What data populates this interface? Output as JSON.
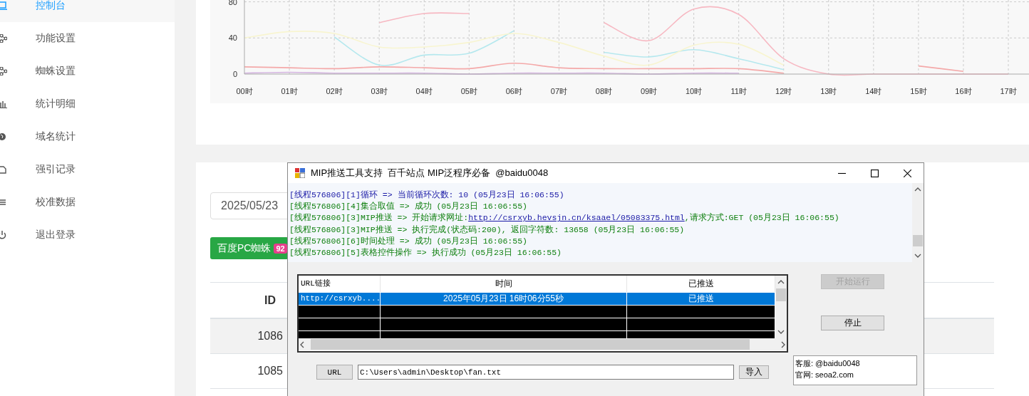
{
  "sidebar": {
    "items": [
      {
        "label": "控制台",
        "selected": true
      },
      {
        "label": "功能设置",
        "selected": false
      },
      {
        "label": "蜘蛛设置",
        "selected": false
      },
      {
        "label": "统计明细",
        "selected": false
      },
      {
        "label": "域名统计",
        "selected": false
      },
      {
        "label": "强引记录",
        "selected": false
      },
      {
        "label": "校准数据",
        "selected": false
      },
      {
        "label": "退出登录",
        "selected": false
      }
    ]
  },
  "chart": {
    "chart_data": {
      "type": "line",
      "categories": [
        "00时",
        "01时",
        "02时",
        "03时",
        "04时",
        "05时",
        "06时",
        "07时",
        "08时",
        "09时",
        "10时",
        "11时",
        "12时",
        "13时",
        "14时",
        "15时",
        "16时",
        "17时"
      ],
      "yticks": [
        0,
        40,
        80
      ],
      "ylim": [
        0,
        82
      ],
      "grid": true,
      "series": [
        {
          "color": "#f7b8c2",
          "values": [
            null,
            null,
            null,
            57,
            67,
            67,
            null,
            null,
            57,
            37,
            72,
            66,
            17,
            0,
            0,
            0,
            0,
            0
          ]
        },
        {
          "color": "#b5e8ee",
          "values": [
            null,
            null,
            41,
            10,
            21,
            23,
            48,
            null,
            24,
            19,
            27,
            17,
            5,
            null,
            null,
            null,
            null,
            null
          ]
        },
        {
          "color": "#f8f5d0",
          "values": [
            40,
            47,
            45,
            30,
            30,
            35,
            45,
            35,
            20,
            10,
            32,
            33,
            10,
            null,
            null,
            null,
            null,
            null
          ]
        },
        {
          "color": "#f4a9a9",
          "values": [
            8,
            7,
            6,
            8,
            7,
            6,
            12,
            7,
            6,
            6,
            6,
            6,
            1,
            null,
            null,
            9,
            3,
            null
          ]
        },
        {
          "color": "#d4b4e0",
          "values": [
            1,
            2,
            1,
            1,
            1,
            0,
            1,
            1,
            1,
            0,
            1,
            1,
            null,
            null,
            null,
            null,
            null,
            null
          ]
        }
      ]
    }
  },
  "filter": {
    "date": "2025/05/23"
  },
  "spider_button": {
    "label": "百度PC蜘蛛",
    "count": "92"
  },
  "table": {
    "columns": [
      "ID"
    ],
    "rows": [
      [
        "1086"
      ],
      [
        "1085"
      ]
    ]
  },
  "dialog": {
    "title": "MIP推送工具支持  百千站点 MIP泛程序必备  @baidu0048",
    "log": [
      {
        "text": "[线程576806][1]循环 => 当前循环次数: 10 (05月23日 16:06:55)",
        "color": "#1a1aa6"
      },
      {
        "text": "[线程576806][4]集合取值 => 成功 (05月23日 16:06:55)",
        "color": "#108010"
      },
      {
        "text": "[线程576806][3]MIP推送 => 开始请求网址:",
        "link": "http://csrxyb.hevsjn.cn/ksaael/05083375.html",
        "suffix": ",请求方式:GET (05月23日 16:06:55)",
        "color": "#108010"
      },
      {
        "text": "[线程576806][3]MIP推送 => 执行完成(状态码:200), 返回字符数: 13658 (05月23日 16:06:55)",
        "color": "#108010"
      },
      {
        "text": "[线程576806][6]时间处理 => 成功 (05月23日 16:06:55)",
        "color": "#108010"
      },
      {
        "text": "[线程576806][5]表格控件操作 => 执行成功 (05月23日 16:06:55)",
        "color": "#108010"
      }
    ],
    "grid": {
      "columns": [
        "URL链接",
        "时间",
        "已推送"
      ],
      "rows": [
        {
          "cells": [
            "http://csrxyb....",
            "2025年05月23日 16时06分55秒",
            "已推送"
          ],
          "selected": true
        }
      ]
    },
    "start_button": {
      "label": "开始运行",
      "disabled": true
    },
    "stop_button": {
      "label": "停止",
      "disabled": false
    },
    "url_button": "URL",
    "path": "C:\\Users\\admin\\Desktop\\fan.txt",
    "import_button": "导入",
    "info": [
      "客服: @baidu0048",
      "官网: seoa2.com"
    ]
  }
}
